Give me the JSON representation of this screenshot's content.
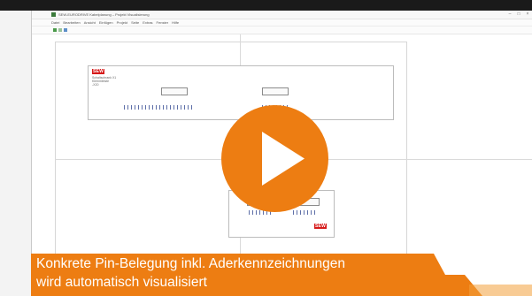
{
  "window": {
    "title": "SEW-EURODRIVE Kabelplanung – Projekt Visualisierung",
    "controls": {
      "minimize": "–",
      "maximize": "□",
      "close": "×"
    },
    "menu_items": [
      "Datei",
      "Bearbeiten",
      "Ansicht",
      "Einfügen",
      "Projekt",
      "Seite",
      "Extras",
      "Fenster",
      "Hilfe"
    ]
  },
  "schematic": {
    "logo_text": "SEW",
    "logo_color": "#d61a1a",
    "block_label_lines": [
      "Schaltschrank X1",
      "Klemmleiste",
      "-X20"
    ]
  },
  "play_button": {
    "icon": "play-icon",
    "color": "#ed7d12"
  },
  "caption": {
    "line1": "Konkrete Pin-Belegung inkl. Aderkennzeichnungen",
    "line2": "wird automatisch visualisiert",
    "background": "#ed7d12"
  }
}
